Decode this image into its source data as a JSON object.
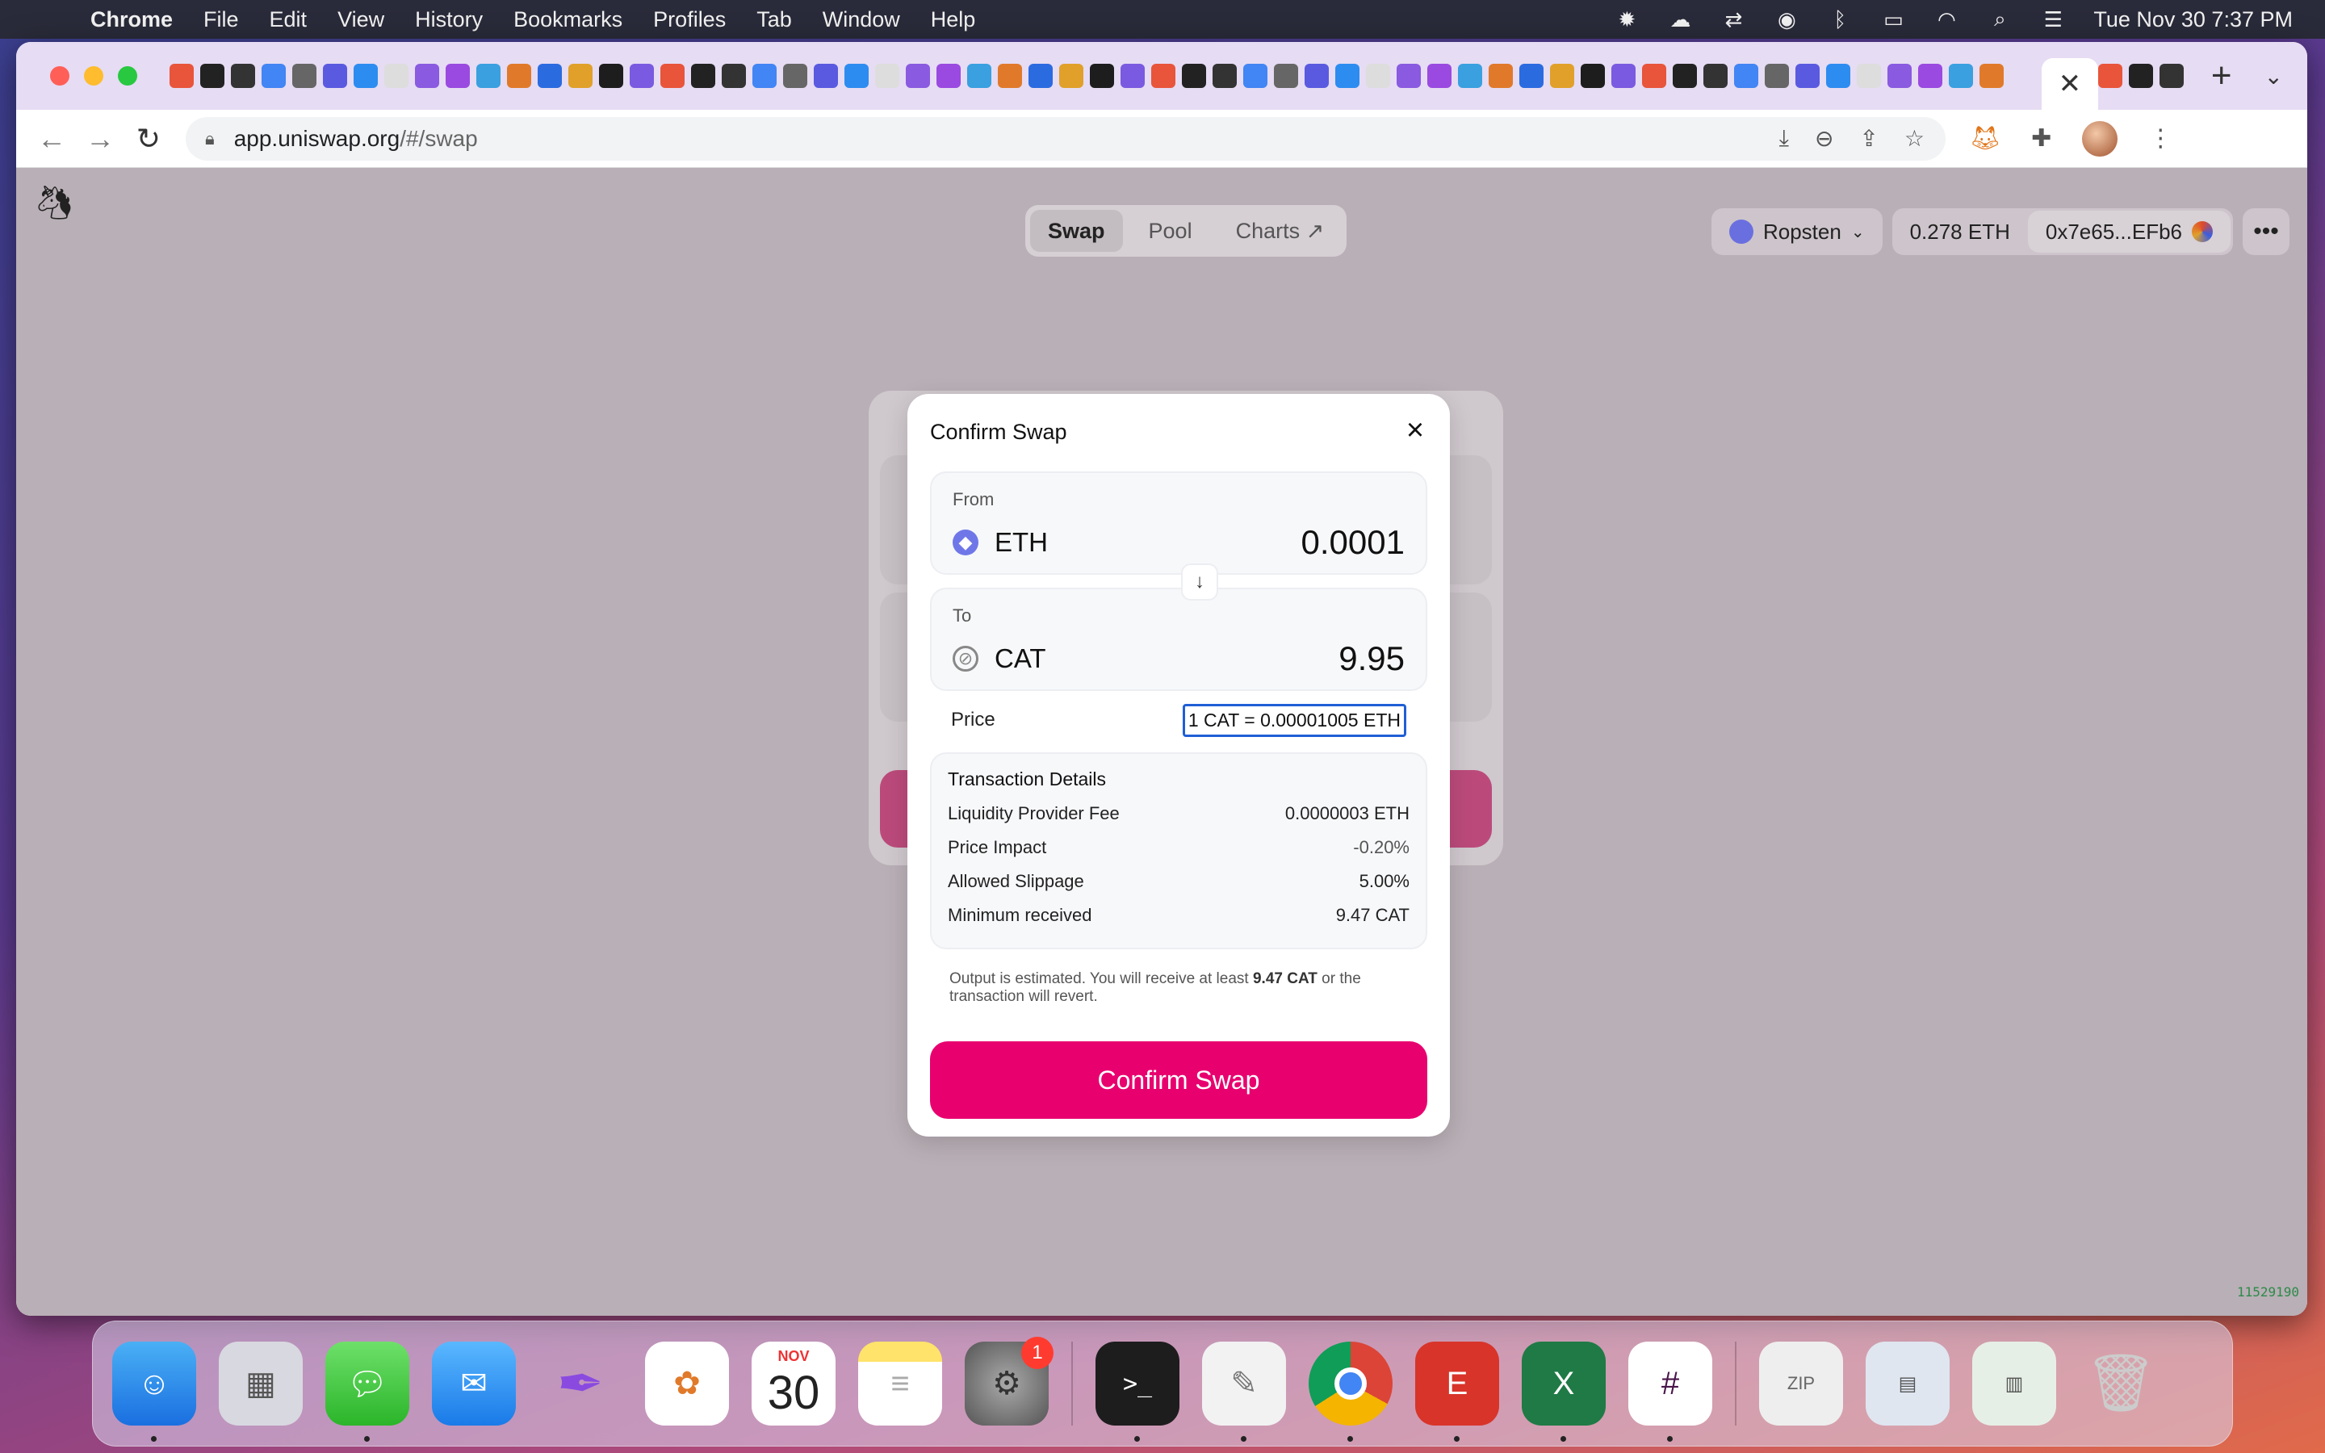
{
  "menubar": {
    "app_name": "Chrome",
    "items": [
      "File",
      "Edit",
      "View",
      "History",
      "Bookmarks",
      "Profiles",
      "Tab",
      "Window",
      "Help"
    ],
    "clock": "Tue Nov 30  7:37 PM"
  },
  "browser": {
    "url_host": "app.uniswap.org",
    "url_path": "/#/swap"
  },
  "uniswap": {
    "nav": {
      "swap": "Swap",
      "pool": "Pool",
      "charts": "Charts ↗"
    },
    "network": "Ropsten",
    "balance": "0.278 ETH",
    "account": "0x7e65...EFb6",
    "version": "11529190"
  },
  "modal": {
    "title": "Confirm Swap",
    "from": {
      "label": "From",
      "symbol": "ETH",
      "amount": "0.0001"
    },
    "to": {
      "label": "To",
      "symbol": "CAT",
      "amount": "9.95"
    },
    "price_label": "Price",
    "price_value": "1 CAT = 0.00001005 ETH",
    "details": {
      "title": "Transaction Details",
      "rows": [
        {
          "label": "Liquidity Provider Fee",
          "value": "0.0000003 ETH"
        },
        {
          "label": "Price Impact",
          "value": "-0.20%"
        },
        {
          "label": "Allowed Slippage",
          "value": "5.00%"
        },
        {
          "label": "Minimum received",
          "value": "9.47 CAT"
        }
      ]
    },
    "note_prefix": "Output is estimated. You will receive at least ",
    "note_amount": "9.47 CAT",
    "note_suffix": " or the transaction will revert.",
    "confirm_label": "Confirm Swap"
  },
  "dock": {
    "calendar_month": "NOV",
    "calendar_day": "30",
    "settings_badge": "1"
  },
  "colors": {
    "accent_pink": "#e8006f",
    "focus_blue": "#1f5fd6"
  }
}
